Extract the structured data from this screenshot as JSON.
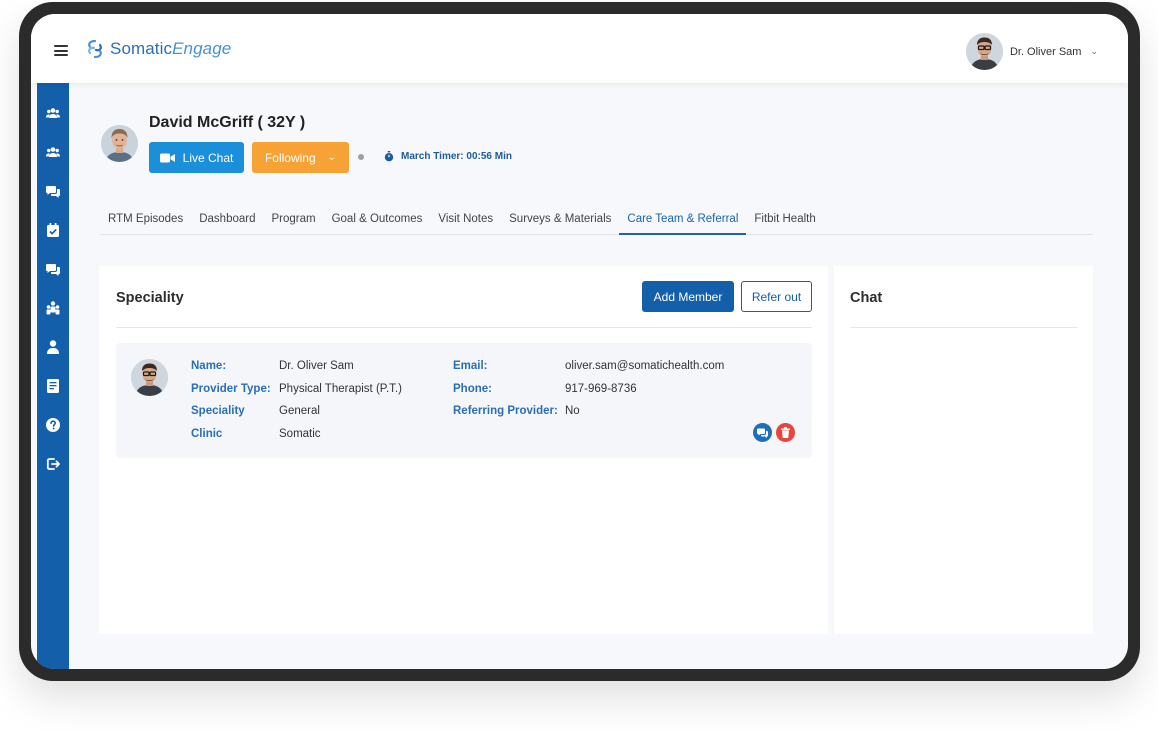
{
  "app": {
    "logo": {
      "part1": "Somatic",
      "part2": "Engage"
    },
    "user": {
      "name": "Dr. Oliver Sam"
    }
  },
  "sidebar": {
    "items": [
      {
        "name": "patients-icon"
      },
      {
        "name": "groups-icon"
      },
      {
        "name": "messages-icon"
      },
      {
        "name": "calendar-icon"
      },
      {
        "name": "chat-icon"
      },
      {
        "name": "team-icon"
      },
      {
        "name": "user-icon"
      },
      {
        "name": "notes-icon"
      },
      {
        "name": "help-icon"
      },
      {
        "name": "logout-icon"
      }
    ]
  },
  "patient": {
    "name": "David McGriff ( 32Y )",
    "live_chat_label": "Live Chat",
    "following_label": "Following",
    "timer_label": "March Timer: 00:56 Min"
  },
  "tabs": [
    {
      "label": "RTM Episodes",
      "active": false
    },
    {
      "label": "Dashboard",
      "active": false
    },
    {
      "label": "Program",
      "active": false
    },
    {
      "label": "Goal & Outcomes",
      "active": false
    },
    {
      "label": "Visit Notes",
      "active": false
    },
    {
      "label": "Surveys & Materials",
      "active": false
    },
    {
      "label": "Care Team & Referral",
      "active": true
    },
    {
      "label": "Fitbit Health",
      "active": false
    }
  ],
  "speciality": {
    "title": "Speciality",
    "add_member_label": "Add Member",
    "refer_out_label": "Refer out",
    "member": {
      "name_label": "Name:",
      "name": "Dr. Oliver Sam",
      "provider_type_label": "Provider Type:",
      "provider_type": "Physical Therapist (P.T.)",
      "speciality_label": "Speciality",
      "speciality": "General",
      "clinic_label": "Clinic",
      "clinic": "Somatic",
      "email_label": "Email:",
      "email": "oliver.sam@somatichealth.com",
      "phone_label": "Phone:",
      "phone": "917-969-8736",
      "referring_label": "Referring Provider:",
      "referring": "No"
    }
  },
  "chat": {
    "title": "Chat"
  },
  "colors": {
    "primary": "#135fa9",
    "live_chat": "#1b8fd9",
    "following": "#f7a235",
    "chat_action": "#1f6fb8",
    "delete_action": "#e8453c"
  }
}
